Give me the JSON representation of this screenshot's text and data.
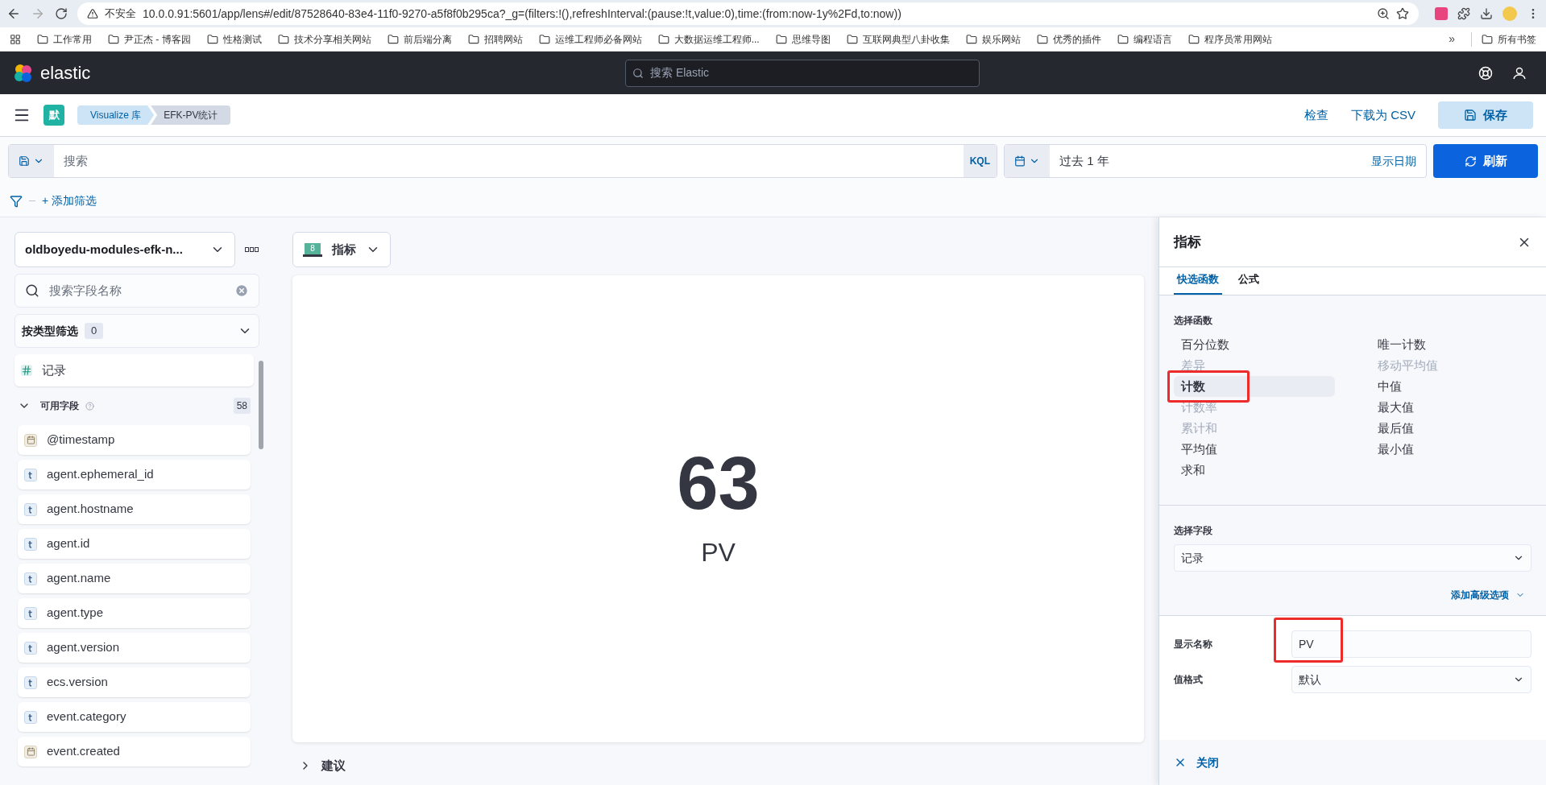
{
  "browser": {
    "security": "不安全",
    "url": "10.0.0.91:5601/app/lens#/edit/87528640-83e4-11f0-9270-a5f8f0b295ca?_g=(filters:!(),refreshInterval:(pause:!t,value:0),time:(from:now-1y%2Fd,to:now))",
    "bookmarks": [
      "工作常用",
      "尹正杰 - 博客园",
      "性格测试",
      "技术分享相关网站",
      "前后端分离",
      "招聘网站",
      "运维工程师必备网站",
      "大数据运维工程师...",
      "思维导图",
      "互联网典型八卦收集",
      "娱乐网站",
      "优秀的插件",
      "编程语言",
      "程序员常用网站"
    ],
    "more": "»",
    "all_bookmarks": "所有书签"
  },
  "header": {
    "logo": "elastic",
    "search_placeholder": "搜索 Elastic"
  },
  "breadcrumb": {
    "space": "默",
    "items": [
      {
        "label": "Visualize 库",
        "selected": false
      },
      {
        "label": "EFK-PV统计",
        "selected": true
      }
    ],
    "actions": [
      "检查",
      "下载为 CSV"
    ],
    "save": "保存"
  },
  "query": {
    "placeholder": "搜索",
    "language": "KQL",
    "time": "过去 1 年",
    "show_dates": "显示日期",
    "refresh": "刷新",
    "add_filter": "+ 添加筛选"
  },
  "sidebar": {
    "data_view": "oldboyedu-modules-efk-n...",
    "search_placeholder": "搜索字段名称",
    "type_filter": "按类型筛选",
    "type_filter_count": "0",
    "records": "记录",
    "available": {
      "label": "可用字段",
      "count": "58",
      "expanded": true
    },
    "fields": [
      {
        "name": "@timestamp",
        "kind": "date"
      },
      {
        "name": "agent.ephemeral_id",
        "kind": "text"
      },
      {
        "name": "agent.hostname",
        "kind": "text"
      },
      {
        "name": "agent.id",
        "kind": "text"
      },
      {
        "name": "agent.name",
        "kind": "text"
      },
      {
        "name": "agent.type",
        "kind": "text"
      },
      {
        "name": "agent.version",
        "kind": "text"
      },
      {
        "name": "ecs.version",
        "kind": "text"
      },
      {
        "name": "event.category",
        "kind": "text"
      },
      {
        "name": "event.created",
        "kind": "date"
      }
    ]
  },
  "workspace": {
    "chart_type": "指标",
    "chart_badge": "8",
    "metric_value": "63",
    "metric_label": "PV",
    "suggestions": "建议"
  },
  "panel": {
    "title": "指标",
    "tabs": [
      {
        "label": "快选函数",
        "selected": true
      },
      {
        "label": "公式",
        "selected": false
      }
    ],
    "functions_label": "选择函数",
    "functions": [
      {
        "label": "百分位数",
        "disabled": false,
        "selected": false
      },
      {
        "label": "唯一计数",
        "disabled": false,
        "selected": false
      },
      {
        "label": "差异",
        "disabled": true,
        "selected": false
      },
      {
        "label": "移动平均值",
        "disabled": true,
        "selected": false
      },
      {
        "label": "计数",
        "disabled": false,
        "selected": true
      },
      {
        "label": "中值",
        "disabled": false,
        "selected": false
      },
      {
        "label": "计数率",
        "disabled": true,
        "selected": false
      },
      {
        "label": "最大值",
        "disabled": false,
        "selected": false
      },
      {
        "label": "累计和",
        "disabled": true,
        "selected": false
      },
      {
        "label": "最后值",
        "disabled": false,
        "selected": false
      },
      {
        "label": "平均值",
        "disabled": false,
        "selected": false
      },
      {
        "label": "最小值",
        "disabled": false,
        "selected": false
      },
      {
        "label": "求和",
        "disabled": false,
        "selected": false
      }
    ],
    "field_label": "选择字段",
    "field_value": "记录",
    "advanced": "添加高级选项",
    "display_name_label": "显示名称",
    "display_name": "PV",
    "format_label": "值格式",
    "format_value": "默认",
    "close": "关闭"
  }
}
